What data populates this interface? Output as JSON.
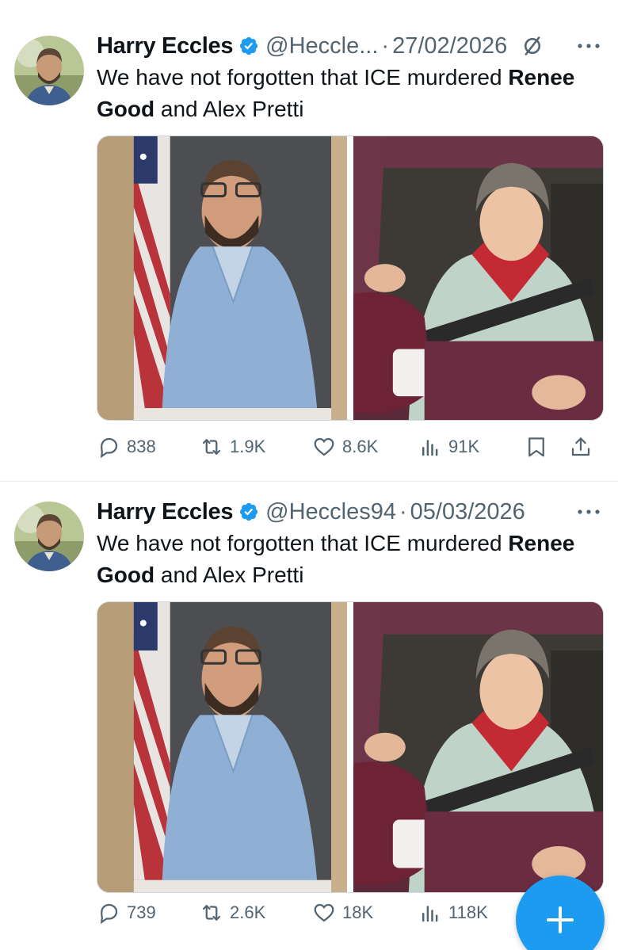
{
  "tweets": [
    {
      "author": "Harry Eccles",
      "handle": "@Heccle...",
      "separator": "·",
      "date": "27/02/2026",
      "edited": true,
      "text_part1": "We have not forgotten that ICE murdered ",
      "text_bold1": "Renee Good",
      "text_part2": " and Alex Pretti",
      "stats": {
        "replies": "838",
        "reposts": "1.9K",
        "likes": "8.6K",
        "views": "91K"
      }
    },
    {
      "author": "Harry Eccles",
      "handle": "@Heccles94",
      "separator": "·",
      "date": "05/03/2026",
      "edited": false,
      "text_part1": "We have not forgotten that ICE murdered ",
      "text_bold1": "Renee Good",
      "text_part2": " and Alex Pretti",
      "stats": {
        "replies": "739",
        "reposts": "2.6K",
        "likes": "18K",
        "views": "118K"
      }
    }
  ],
  "icons": {
    "verified": "verified-badge-icon",
    "edited": "edited-slash-icon",
    "more": "more-dots-icon",
    "reply": "reply-icon",
    "repost": "repost-icon",
    "like": "heart-icon",
    "views": "views-bar-icon",
    "bookmark": "bookmark-icon",
    "share": "share-icon",
    "compose": "plus-icon"
  },
  "colors": {
    "accent": "#1d9bf0",
    "secondary_text": "#536471",
    "primary_text": "#0f1419"
  }
}
